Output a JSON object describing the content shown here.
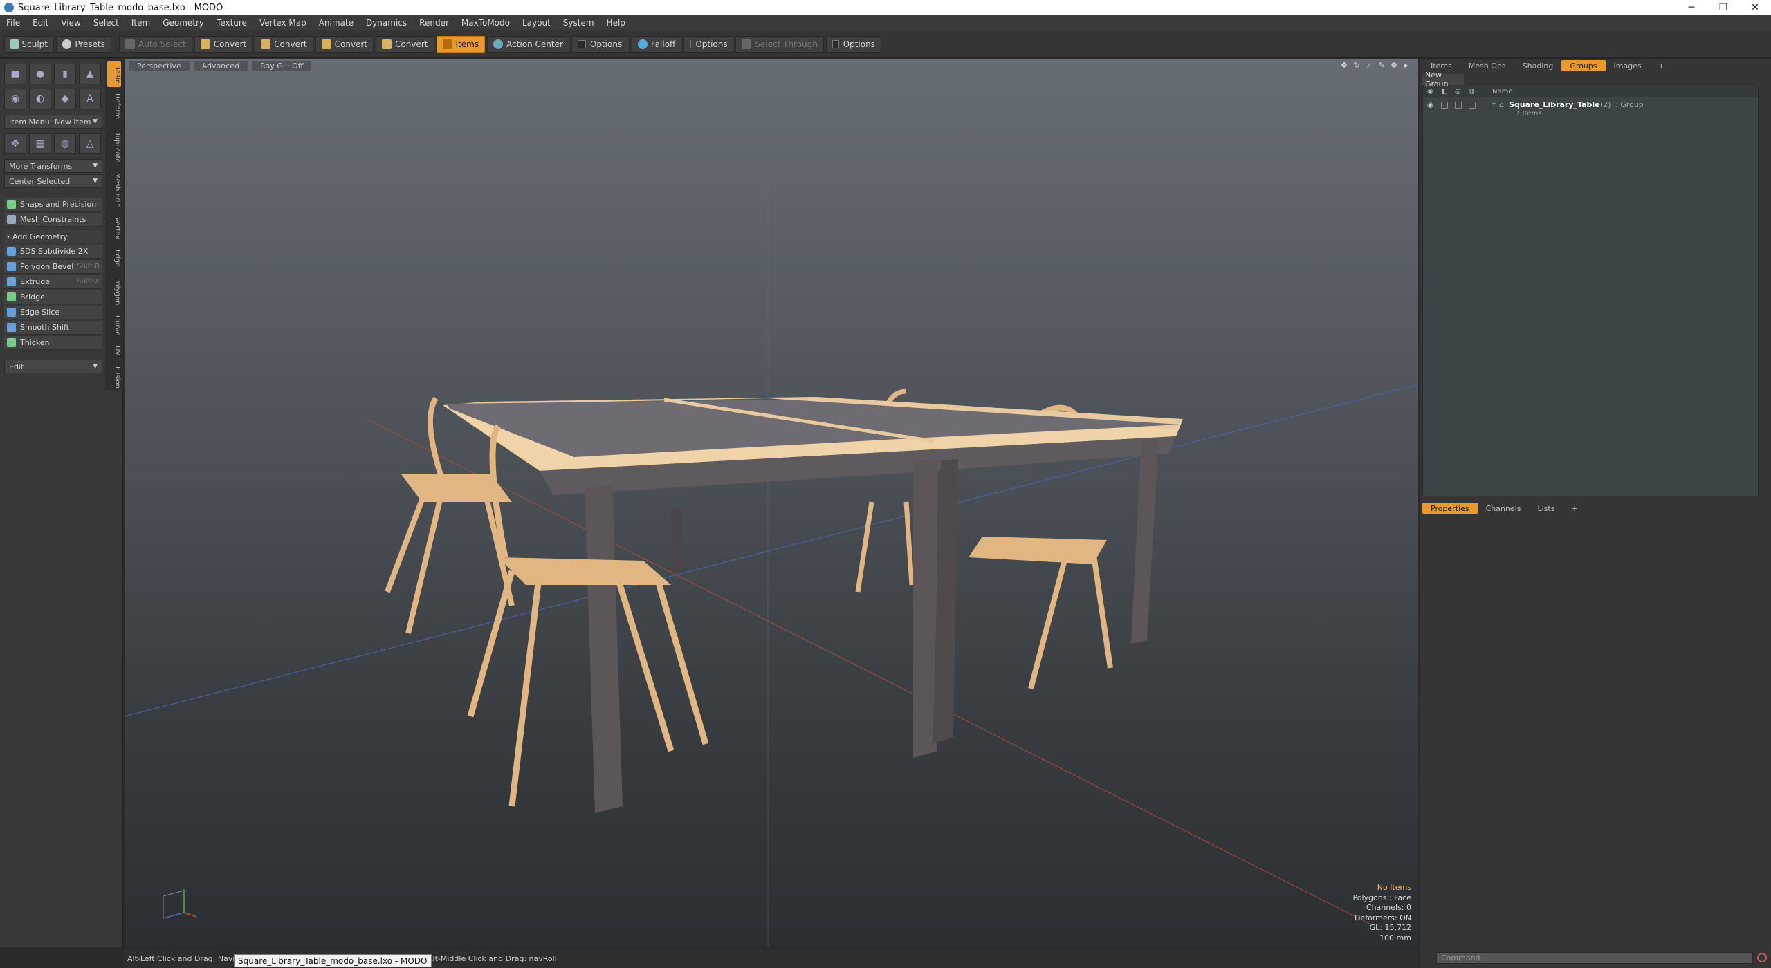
{
  "window": {
    "title": "Square_Library_Table_modo_base.lxo - MODO",
    "minimize": "─",
    "restore": "❐",
    "close": "✕"
  },
  "menu": [
    "File",
    "Edit",
    "View",
    "Select",
    "Item",
    "Geometry",
    "Texture",
    "Vertex Map",
    "Animate",
    "Dynamics",
    "Render",
    "MaxToModo",
    "Layout",
    "System",
    "Help"
  ],
  "toolbar": {
    "sculpt": "Sculpt",
    "presets": "Presets",
    "auto_select": "Auto Select",
    "convert1": "Convert",
    "convert2": "Convert",
    "convert3": "Convert",
    "convert4": "Convert",
    "items": "Items",
    "action_center": "Action Center",
    "options1": "Options",
    "falloff": "Falloff",
    "options2": "Options",
    "select_through": "Select Through",
    "options3": "Options"
  },
  "left": {
    "vtabs": [
      "Basic",
      "Deform",
      "Duplicate",
      "Mesh Edit",
      "Vertex",
      "Edge",
      "Polygon",
      "Curve",
      "UV",
      "Fusion"
    ],
    "item_menu": "Item Menu: New Item",
    "more_transforms": "More Transforms",
    "center_selected": "Center Selected",
    "snaps": "Snaps and Precision",
    "mesh_constraints": "Mesh Constraints",
    "add_geometry": "Add Geometry",
    "tools": [
      {
        "label": "SDS Subdivide 2X",
        "hotkey": ""
      },
      {
        "label": "Polygon Bevel",
        "hotkey": "Shift-B"
      },
      {
        "label": "Extrude",
        "hotkey": "Shift-X"
      },
      {
        "label": "Bridge",
        "hotkey": ""
      },
      {
        "label": "Edge Slice",
        "hotkey": ""
      },
      {
        "label": "Smooth Shift",
        "hotkey": ""
      },
      {
        "label": "Thicken",
        "hotkey": ""
      }
    ],
    "edit": "Edit"
  },
  "viewport": {
    "perspective": "Perspective",
    "advanced": "Advanced",
    "raygl": "Ray GL: Off",
    "info": {
      "no_items": "No Items",
      "polygons": "Polygons : Face",
      "channels": "Channels: 0",
      "deformers": "Deformers: ON",
      "gl": "GL: 15,712",
      "scale": "100 mm"
    }
  },
  "status": {
    "text_left": "Alt-Left Click and Drag: Navigati",
    "text_right": "ation: Freewheel ● Alt-Middle Click and Drag: navRoll",
    "tooltip": "Square_Library_Table_modo_base.lxo - MODO"
  },
  "right": {
    "tabs": [
      "Items",
      "Mesh Ops",
      "Shading",
      "Groups",
      "Images",
      "+"
    ],
    "new_group": "New Group",
    "col_name": "Name",
    "group_name": "Square_Library_Table",
    "group_count": "(2)",
    "group_type": ": Group",
    "group_sub": "7 Items",
    "prop_tabs": [
      "Properties",
      "Channels",
      "Lists",
      "+"
    ],
    "command_placeholder": "Command"
  },
  "colors": {
    "accent": "#e89a2c",
    "table_top": "#6e6c72",
    "table_edge": "#e8c9a0",
    "chair_wood": "#e2b682",
    "table_leg": "#5c5658"
  }
}
